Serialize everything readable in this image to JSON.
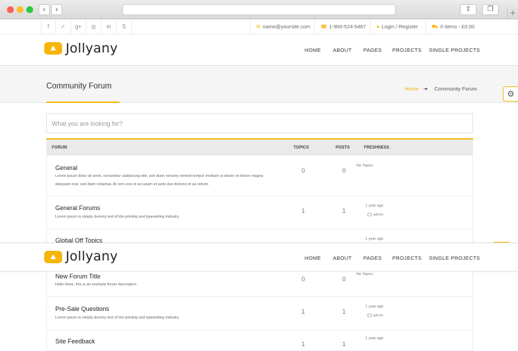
{
  "topbar": {
    "social_icons": [
      "facebook-icon",
      "twitter-icon",
      "google-plus-icon",
      "dribbble-icon",
      "linkedin-icon",
      "skype-icon"
    ],
    "social_glyphs": [
      "f",
      "✓",
      "g+",
      "◎",
      "in",
      "S"
    ],
    "email": "name@yoursite.com",
    "phone": "1-900-524-5467",
    "login": "Login / Register",
    "cart": "0 items - £0.00"
  },
  "header": {
    "logo": "Jollyany",
    "menu": [
      "HOME",
      "ABOUT",
      "PAGES",
      "PROJECTS",
      "SINGLE PROJECTS"
    ]
  },
  "page": {
    "title": "Community Forum",
    "breadcrumb_home": "Home",
    "breadcrumb_sep": "➔",
    "breadcrumb_current": "Community Forum"
  },
  "search": {
    "placeholder": "What you are looking for?"
  },
  "table": {
    "headers": {
      "forum": "FORUM",
      "topics": "TOPICS",
      "posts": "POSTS",
      "freshness": "FRESHNESS"
    },
    "rows": [
      {
        "name": "General",
        "desc": "Lorem ipsum dolor sit amet, consetetur sadipscing elitr, sed diam nonumy eirmod tempor invidunt ut labore et dolore magna aliquyam erat, sed diam voluptua. At vero eos et accusam et justo duo dolores et ea rebum.",
        "topics": "0",
        "posts": "0",
        "fresh": "No Topics",
        "user": ""
      },
      {
        "name": "General Forums",
        "desc": "Lorem ipsum is simply dummy text of the printing and typesetting industry.",
        "topics": "1",
        "posts": "1",
        "fresh": "1 year ago",
        "user": "admin"
      },
      {
        "name": "Global Off Topics",
        "desc": "",
        "topics": "",
        "posts": "",
        "fresh": "1 year ago",
        "user": ""
      },
      {
        "name": "New Forum Title",
        "desc": "Hello there, this is an example forum description.",
        "topics": "0",
        "posts": "0",
        "fresh": "No Topics",
        "user": ""
      },
      {
        "name": "Pre-Sale Questions",
        "desc": "Lorem ipsum is simply dummy text of the printing and typesetting industry.",
        "topics": "1",
        "posts": "1",
        "fresh": "1 year ago",
        "user": "admin"
      },
      {
        "name": "Site Feedback",
        "desc": "",
        "topics": "1",
        "posts": "1",
        "fresh": "1 year ago",
        "user": ""
      }
    ]
  },
  "colors": {
    "accent": "#f5b50a"
  }
}
